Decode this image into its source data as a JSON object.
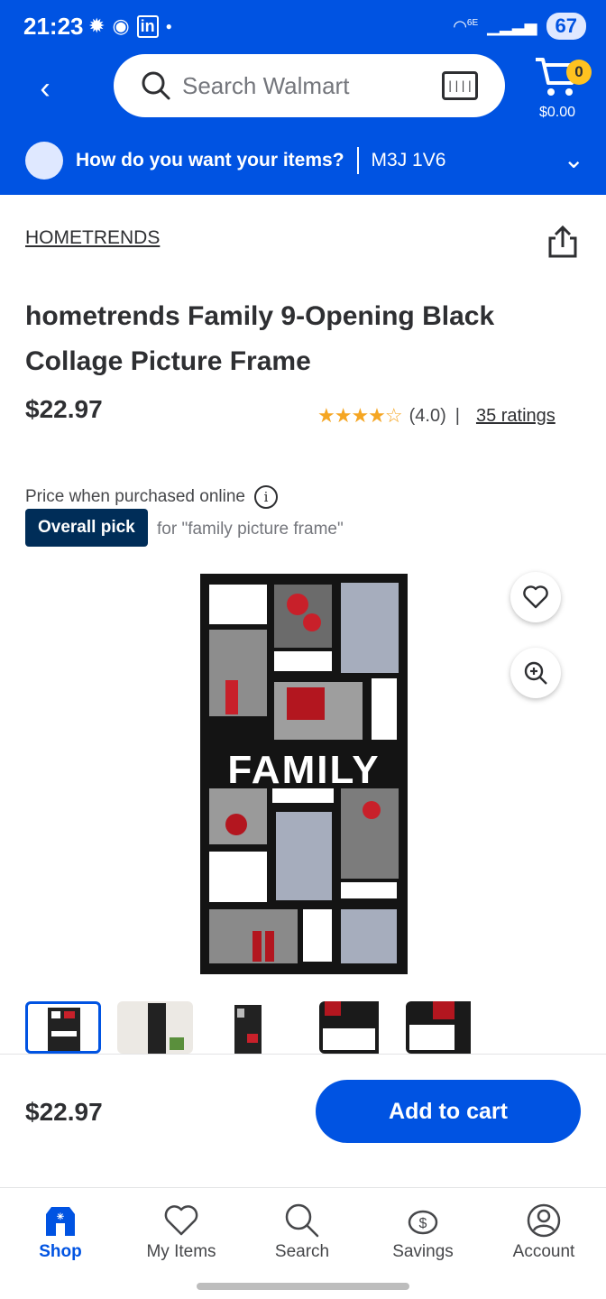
{
  "status": {
    "time": "21:23",
    "battery": "67",
    "network": "6E"
  },
  "header": {
    "search_placeholder": "Search Walmart",
    "cart_count": "0",
    "cart_total": "$0.00"
  },
  "delivery": {
    "question": "How do you want your items?",
    "zip": "M3J 1V6"
  },
  "product": {
    "brand": "HOMETRENDS",
    "title": "hometrends Family 9-Opening Black Collage Picture Frame",
    "price": "$22.97",
    "rating_value": "(4.0)",
    "rating_separator": "|",
    "ratings_link": "35 ratings",
    "stars": 4,
    "price_note": "Price when purchased online",
    "badge": "Overall pick",
    "badge_for": "for \"family picture frame\""
  },
  "photo": {
    "word": "FAMILY"
  },
  "thumbnails": {
    "count": 5,
    "active_index": 0
  },
  "bottom": {
    "price": "$22.97",
    "add_to_cart": "Add to cart"
  },
  "nav": {
    "items": [
      {
        "label": "Shop"
      },
      {
        "label": "My Items"
      },
      {
        "label": "Search"
      },
      {
        "label": "Savings"
      },
      {
        "label": "Account"
      }
    ]
  },
  "colors": {
    "brand_blue": "#0053e2",
    "badge_navy": "#002d58",
    "cart_badge": "#ffc220",
    "star": "#f5a623"
  }
}
